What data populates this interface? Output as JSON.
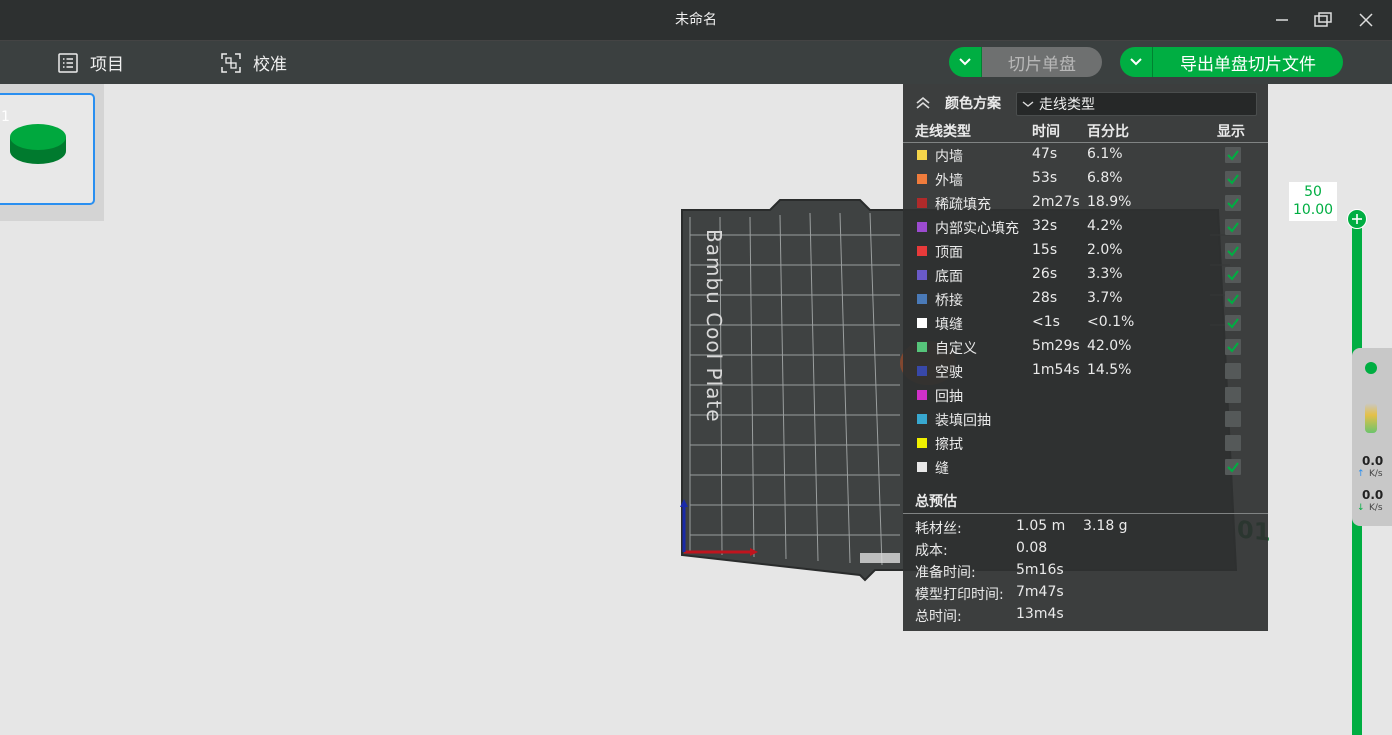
{
  "window": {
    "title": "未命名",
    "controls": [
      "minimize-icon",
      "restore-icon",
      "close-icon"
    ]
  },
  "menubar": {
    "items": [
      {
        "label": "项目",
        "icon": "list-icon"
      },
      {
        "label": "校准",
        "icon": "calibrate-icon"
      }
    ],
    "slice_button": "切片单盘",
    "export_button": "导出单盘切片文件"
  },
  "plate": {
    "index": "1",
    "bed_name": "Bambu Cool Plate",
    "plate_number": "01"
  },
  "legend": {
    "scheme_label": "颜色方案",
    "scheme_value": "走线类型",
    "headers": {
      "type": "走线类型",
      "time": "时间",
      "percent": "百分比",
      "show": "显示"
    },
    "rows": [
      {
        "name": "内墙",
        "time": "47s",
        "percent": "6.1%",
        "color": "#f5d54a",
        "shown": true
      },
      {
        "name": "外墙",
        "time": "53s",
        "percent": "6.8%",
        "color": "#f07c3c",
        "shown": true
      },
      {
        "name": "稀疏填充",
        "time": "2m27s",
        "percent": "18.9%",
        "color": "#b02a2a",
        "shown": true
      },
      {
        "name": "内部实心填充",
        "time": "32s",
        "percent": "4.2%",
        "color": "#9c4bd0",
        "shown": true
      },
      {
        "name": "顶面",
        "time": "15s",
        "percent": "2.0%",
        "color": "#e83a3a",
        "shown": true
      },
      {
        "name": "底面",
        "time": "26s",
        "percent": "3.3%",
        "color": "#6a5ac8",
        "shown": true
      },
      {
        "name": "桥接",
        "time": "28s",
        "percent": "3.7%",
        "color": "#4a7ab8",
        "shown": true
      },
      {
        "name": "填缝",
        "time": "<1s",
        "percent": "<0.1%",
        "color": "#ffffff",
        "shown": true
      },
      {
        "name": "自定义",
        "time": "5m29s",
        "percent": "42.0%",
        "color": "#56c47a",
        "shown": true
      },
      {
        "name": "空驶",
        "time": "1m54s",
        "percent": "14.5%",
        "color": "#3848a8",
        "shown": false
      },
      {
        "name": "回抽",
        "time": "",
        "percent": "",
        "color": "#d030c8",
        "shown": false
      },
      {
        "name": "装填回抽",
        "time": "",
        "percent": "",
        "color": "#38a8d0",
        "shown": false
      },
      {
        "name": "擦拭",
        "time": "",
        "percent": "",
        "color": "#f0f000",
        "shown": false
      },
      {
        "name": "缝",
        "time": "",
        "percent": "",
        "color": "#e8e8e8",
        "shown": true
      }
    ],
    "summary_title": "总预估",
    "summary": [
      {
        "label": "耗材丝:",
        "value": "1.05 m    3.18 g"
      },
      {
        "label": "成本:",
        "value": "0.08"
      },
      {
        "label": "准备时间:",
        "value": "5m16s"
      },
      {
        "label": "模型打印时间:",
        "value": "7m47s"
      },
      {
        "label": "总时间:",
        "value": "13m4s"
      }
    ]
  },
  "layer_slider": {
    "layer": "50",
    "height": "10.00"
  },
  "network": {
    "upload": "0.0",
    "download": "0.0",
    "unit": "K/s"
  },
  "colors": {
    "accent": "#00ae42",
    "titlebar": "#2d3030",
    "menubar": "#3b4040",
    "selection": "#2a8ff0"
  }
}
